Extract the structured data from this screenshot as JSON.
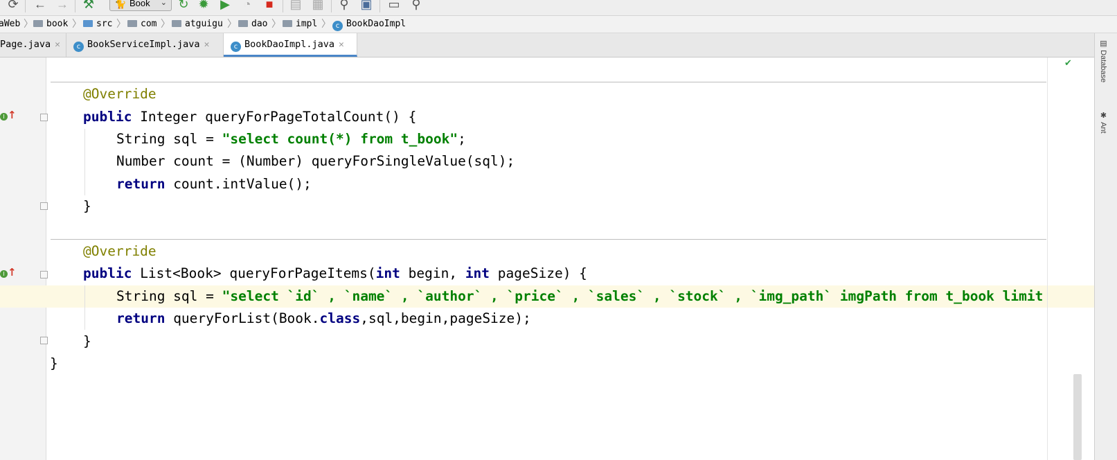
{
  "toolbar": {
    "run_config": "Book",
    "icons": [
      "sync-icon",
      "back-icon",
      "forward-icon",
      "build-icon",
      "run-config-icon",
      "rerun-icon",
      "debug-icon",
      "coverage-icon",
      "profile-icon",
      "stop-icon",
      "deploy-icon",
      "structure-icon",
      "wrench-icon",
      "project-structure-icon",
      "run-window-icon",
      "search-icon"
    ]
  },
  "breadcrumb": {
    "items": [
      {
        "label": "aWeb",
        "icon": "project-icon"
      },
      {
        "label": "book",
        "icon": "module-folder-icon"
      },
      {
        "label": "src",
        "icon": "source-folder-icon"
      },
      {
        "label": "com",
        "icon": "package-folder-icon"
      },
      {
        "label": "atguigu",
        "icon": "package-folder-icon"
      },
      {
        "label": "dao",
        "icon": "package-folder-icon"
      },
      {
        "label": "impl",
        "icon": "package-folder-icon"
      },
      {
        "label": "BookDaoImpl",
        "icon": "class-icon"
      }
    ]
  },
  "tabs": [
    {
      "label": "Page.java",
      "active": false,
      "icon": ""
    },
    {
      "label": "BookServiceImpl.java",
      "active": false,
      "icon": "class-icon"
    },
    {
      "label": "BookDaoImpl.java",
      "active": true,
      "icon": "class-icon"
    }
  ],
  "right_tools": {
    "database": "Database",
    "ant": "Ant"
  },
  "colors": {
    "keyword": "#000080",
    "annotation": "#808000",
    "string": "#008000",
    "current_line": "#fdf9e3",
    "active_tab_underline": "#4a86c8"
  },
  "code": {
    "m1": {
      "annotation": "@Override",
      "kw_public": "public",
      "signature": " Integer queryForPageTotalCount() {",
      "l1_decl": "String sql = ",
      "l1_str": "\"select count(*) from t_book\"",
      "l1_end": ";",
      "l2": "Number count = (Number) queryForSingleValue(sql);",
      "l3_kw": "return",
      "l3_rest": " count.intValue();",
      "close": "}"
    },
    "m2": {
      "annotation": "@Override",
      "kw_public": "public",
      "sig_a": " List<Book> queryForPageItems(",
      "kw_int1": "int",
      "sig_b": " begin, ",
      "kw_int2": "int",
      "sig_c": " pageSize) {",
      "l1_decl": "String sql = ",
      "l1_str": "\"select `id` , `name` , `author` , `price` , `sales` , `stock` , `img_path` imgPath from t_book limit ",
      "l2_kw": "return",
      "l2_a": " queryForList(Book.",
      "l2_kw_class": "class",
      "l2_b": ",sql,begin,pageSize);",
      "close": "}"
    },
    "class_close": "}"
  }
}
